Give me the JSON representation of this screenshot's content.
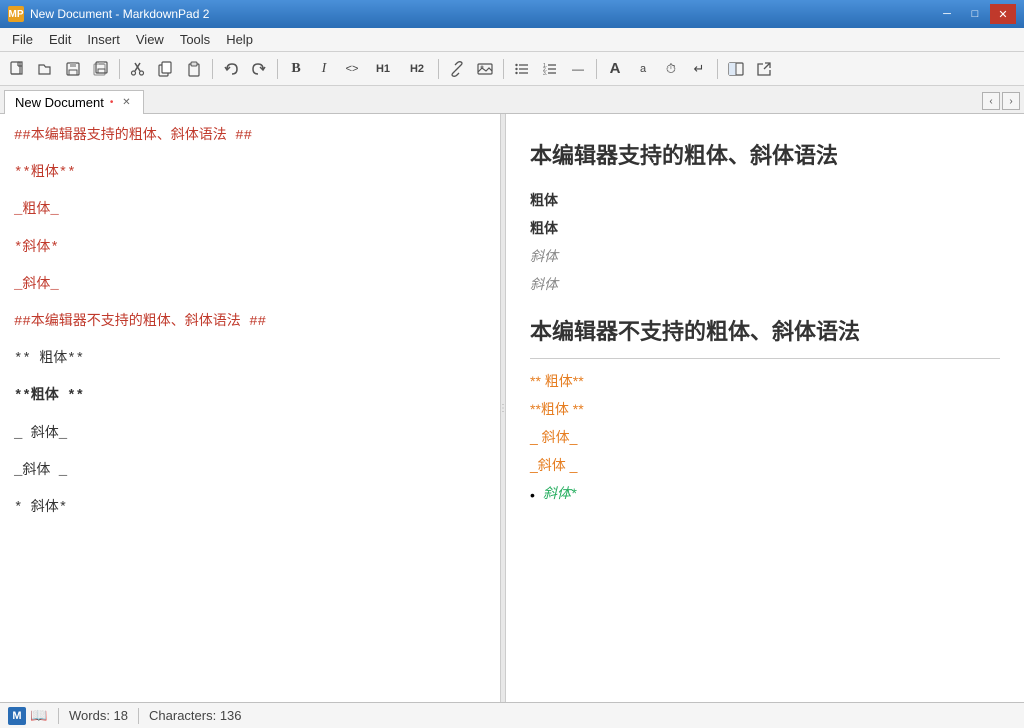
{
  "titlebar": {
    "icon": "MP",
    "title": "New Document - MarkdownPad 2",
    "minimize": "─",
    "maximize": "□",
    "close": "✕"
  },
  "menubar": {
    "items": [
      "File",
      "Edit",
      "Insert",
      "View",
      "Tools",
      "Help"
    ]
  },
  "toolbar": {
    "buttons": [
      {
        "name": "new",
        "icon": "📄"
      },
      {
        "name": "open",
        "icon": "📂"
      },
      {
        "name": "save",
        "icon": "💾"
      },
      {
        "name": "save-all",
        "icon": "🗋"
      },
      {
        "name": "cut",
        "icon": "✂"
      },
      {
        "name": "copy",
        "icon": "📋"
      },
      {
        "name": "paste",
        "icon": "📌"
      },
      {
        "name": "undo",
        "icon": "↶"
      },
      {
        "name": "redo",
        "icon": "↷"
      },
      {
        "name": "bold",
        "icon": "B"
      },
      {
        "name": "italic",
        "icon": "I"
      },
      {
        "name": "code",
        "icon": "<>"
      },
      {
        "name": "h1",
        "icon": "H1"
      },
      {
        "name": "h2",
        "icon": "H2"
      },
      {
        "name": "link",
        "icon": "🔗"
      },
      {
        "name": "image",
        "icon": "🖼"
      },
      {
        "name": "ul",
        "icon": "≡"
      },
      {
        "name": "ol",
        "icon": "≡"
      },
      {
        "name": "hr",
        "icon": "—"
      },
      {
        "name": "bigA",
        "icon": "A"
      },
      {
        "name": "smallA",
        "icon": "a"
      },
      {
        "name": "clock",
        "icon": "⏱"
      },
      {
        "name": "arrow",
        "icon": "↵"
      },
      {
        "name": "preview",
        "icon": "👁"
      },
      {
        "name": "export",
        "icon": "↗"
      }
    ]
  },
  "tab": {
    "label": "New Document",
    "modified": "•",
    "close": "✕"
  },
  "editor": {
    "lines": [
      {
        "text": "##本编辑器支持的粗体、斜体语法 ##",
        "style": "red"
      },
      {
        "text": "",
        "style": "empty"
      },
      {
        "text": "**粗体**",
        "style": "red"
      },
      {
        "text": "",
        "style": "empty"
      },
      {
        "text": "_粗体_",
        "style": "red"
      },
      {
        "text": "",
        "style": "empty"
      },
      {
        "text": "*斜体*",
        "style": "red"
      },
      {
        "text": "",
        "style": "empty"
      },
      {
        "text": "_斜体_",
        "style": "red"
      },
      {
        "text": "",
        "style": "empty"
      },
      {
        "text": "##本编辑器不支持的粗体、斜体语法 ##",
        "style": "red"
      },
      {
        "text": "",
        "style": "empty"
      },
      {
        "text": "** 粗体**",
        "style": "black"
      },
      {
        "text": "",
        "style": "empty"
      },
      {
        "text": "**粗体 **",
        "style": "bold-black"
      },
      {
        "text": "",
        "style": "empty"
      },
      {
        "text": "_ 斜体_",
        "style": "black"
      },
      {
        "text": "",
        "style": "empty"
      },
      {
        "text": "_斜体 _",
        "style": "black"
      },
      {
        "text": "",
        "style": "empty"
      },
      {
        "text": "* 斜体*",
        "style": "black"
      }
    ]
  },
  "preview": {
    "section1_title": "本编辑器支持的粗体、斜体语法",
    "bold1": "粗体",
    "bold2": "粗体",
    "italic1": "斜体",
    "italic2": "斜体",
    "section2_title": "本编辑器不支持的粗体、斜体语法",
    "invalid1": "** 粗体**",
    "invalid2": "**粗体 **",
    "invalid3": "_ 斜体_",
    "invalid4": "_斜体 _",
    "bullet_italic": "斜体*"
  },
  "statusbar": {
    "words_label": "Words: 18",
    "chars_label": "Characters: 136"
  }
}
